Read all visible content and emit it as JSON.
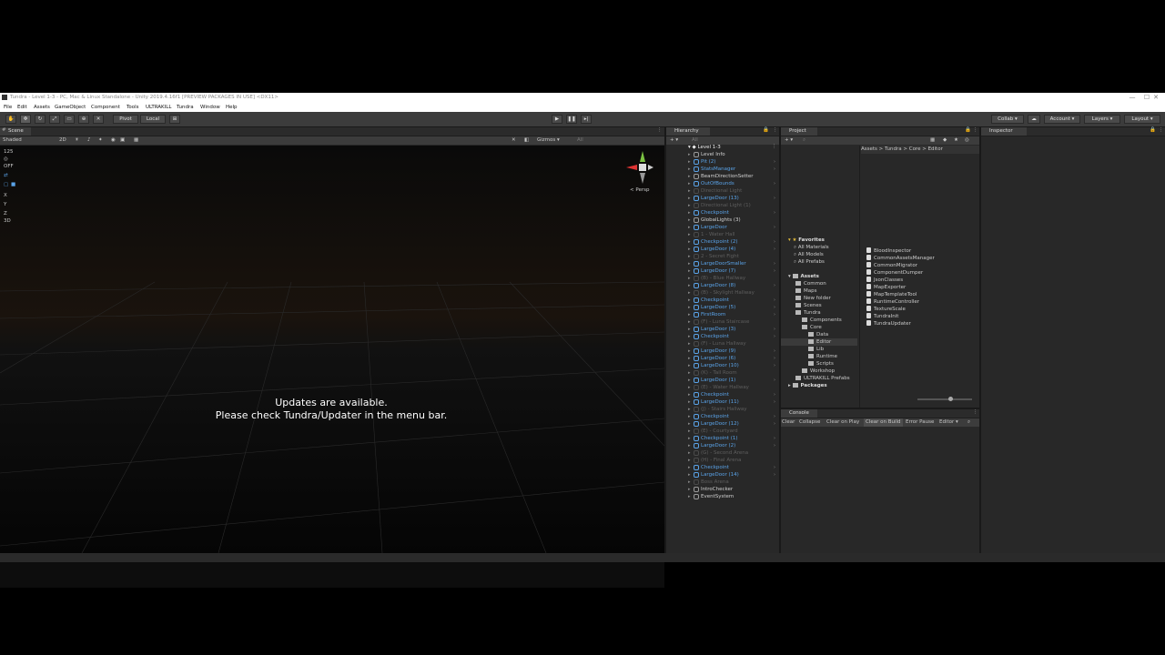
{
  "window": {
    "title": "Tundra - Level 1-3 - PC, Mac & Linux Standalone - Unity 2019.4.16f1 [PREVIEW PACKAGES IN USE] <DX11>",
    "min": "—",
    "max": "☐",
    "close": "✕"
  },
  "menu": [
    "File",
    "Edit",
    "Assets",
    "GameObject",
    "Component",
    "Tools",
    "ULTRAKILL",
    "Tundra",
    "Window",
    "Help"
  ],
  "toolbar": {
    "pivot": "Pivot",
    "local": "Local",
    "collab": "Collab ▾",
    "account": "Account ▾",
    "layers": "Layers ▾",
    "layout": "Layout ▾"
  },
  "scene": {
    "tab": "Scene",
    "shading": "Shaded",
    "mode2d": "2D",
    "gizmos": "Gizmos ▾",
    "search": "All",
    "persp": "< Persp",
    "side": [
      "125",
      "◎",
      "OFF",
      "⇄",
      "▢",
      "■",
      "X",
      "Y",
      "Z",
      "3D"
    ],
    "message_line1": "Updates are available.",
    "message_line2": "Please check Tundra/Updater in the menu bar."
  },
  "hierarchy": {
    "tab": "Hierarchy",
    "search": "All",
    "scene": "Level 1-3",
    "items": [
      {
        "label": "Level Info",
        "color": "#d0d0d0",
        "icon": "#9a9a9a",
        "arrow": false
      },
      {
        "label": "Pit (2)",
        "color": "#5aa3e8",
        "icon": "#5aa3e8",
        "arrow": true
      },
      {
        "label": "StatsManager",
        "color": "#5aa3e8",
        "icon": "#5aa3e8",
        "arrow": true
      },
      {
        "label": "BeamDirectionSetter",
        "color": "#d0d0d0",
        "icon": "#9a9a9a",
        "arrow": false
      },
      {
        "label": "OutOfBounds",
        "color": "#5aa3e8",
        "icon": "#5aa3e8",
        "arrow": true
      },
      {
        "label": "Directional Light",
        "color": "#5e5e5e",
        "icon": "#4a4a4a",
        "arrow": false
      },
      {
        "label": "LargeDoor (13)",
        "color": "#5aa3e8",
        "icon": "#5aa3e8",
        "arrow": true
      },
      {
        "label": "Directional Light (1)",
        "color": "#5e5e5e",
        "icon": "#4a4a4a",
        "arrow": false
      },
      {
        "label": "Checkpoint",
        "color": "#5aa3e8",
        "icon": "#5aa3e8",
        "arrow": true
      },
      {
        "label": "GlobalLights (3)",
        "color": "#d0d0d0",
        "icon": "#9a9a9a",
        "arrow": false
      },
      {
        "label": "LargeDoor",
        "color": "#5aa3e8",
        "icon": "#5aa3e8",
        "arrow": true
      },
      {
        "label": "1 - Water Hall",
        "color": "#5e5e5e",
        "icon": "#4a4a4a",
        "arrow": false
      },
      {
        "label": "Checkpoint (2)",
        "color": "#5aa3e8",
        "icon": "#5aa3e8",
        "arrow": true
      },
      {
        "label": "LargeDoor (4)",
        "color": "#5aa3e8",
        "icon": "#5aa3e8",
        "arrow": true
      },
      {
        "label": "2 - Secret Fight",
        "color": "#5e5e5e",
        "icon": "#4a4a4a",
        "arrow": false
      },
      {
        "label": "LargeDoorSmaller",
        "color": "#5aa3e8",
        "icon": "#5aa3e8",
        "arrow": true
      },
      {
        "label": "LargeDoor (7)",
        "color": "#5aa3e8",
        "icon": "#5aa3e8",
        "arrow": true
      },
      {
        "label": "(B) - Blue Hallway",
        "color": "#5e5e5e",
        "icon": "#4a4a4a",
        "arrow": false
      },
      {
        "label": "LargeDoor (8)",
        "color": "#5aa3e8",
        "icon": "#5aa3e8",
        "arrow": true
      },
      {
        "label": "(B) - Skylight Hallway",
        "color": "#5e5e5e",
        "icon": "#4a4a4a",
        "arrow": false
      },
      {
        "label": "Checkpoint",
        "color": "#5aa3e8",
        "icon": "#5aa3e8",
        "arrow": true
      },
      {
        "label": "LargeDoor (5)",
        "color": "#5aa3e8",
        "icon": "#5aa3e8",
        "arrow": true
      },
      {
        "label": "FirstRoom",
        "color": "#5aa3e8",
        "icon": "#5aa3e8",
        "arrow": true
      },
      {
        "label": "(F) - Luna Staircase",
        "color": "#5e5e5e",
        "icon": "#4a4a4a",
        "arrow": false
      },
      {
        "label": "LargeDoor (3)",
        "color": "#5aa3e8",
        "icon": "#5aa3e8",
        "arrow": true
      },
      {
        "label": "Checkpoint",
        "color": "#5aa3e8",
        "icon": "#5aa3e8",
        "arrow": true
      },
      {
        "label": "(F) - Luna Hallway",
        "color": "#5e5e5e",
        "icon": "#4a4a4a",
        "arrow": false
      },
      {
        "label": "LargeDoor (9)",
        "color": "#5aa3e8",
        "icon": "#5aa3e8",
        "arrow": true
      },
      {
        "label": "LargeDoor (6)",
        "color": "#5aa3e8",
        "icon": "#5aa3e8",
        "arrow": true
      },
      {
        "label": "LargeDoor (10)",
        "color": "#5aa3e8",
        "icon": "#5aa3e8",
        "arrow": true
      },
      {
        "label": "(K) - Tall Room",
        "color": "#5e5e5e",
        "icon": "#4a4a4a",
        "arrow": false
      },
      {
        "label": "LargeDoor (1)",
        "color": "#5aa3e8",
        "icon": "#5aa3e8",
        "arrow": true
      },
      {
        "label": "(E) - Water Hallway",
        "color": "#5e5e5e",
        "icon": "#4a4a4a",
        "arrow": false
      },
      {
        "label": "Checkpoint",
        "color": "#5aa3e8",
        "icon": "#5aa3e8",
        "arrow": true
      },
      {
        "label": "LargeDoor (11)",
        "color": "#5aa3e8",
        "icon": "#5aa3e8",
        "arrow": true
      },
      {
        "label": "(J) - Stairs Hallway",
        "color": "#5e5e5e",
        "icon": "#4a4a4a",
        "arrow": false
      },
      {
        "label": "Checkpoint",
        "color": "#5aa3e8",
        "icon": "#5aa3e8",
        "arrow": true
      },
      {
        "label": "LargeDoor (12)",
        "color": "#5aa3e8",
        "icon": "#5aa3e8",
        "arrow": true
      },
      {
        "label": "(E) - Courtyard",
        "color": "#5e5e5e",
        "icon": "#4a4a4a",
        "arrow": false
      },
      {
        "label": "Checkpoint (1)",
        "color": "#5aa3e8",
        "icon": "#5aa3e8",
        "arrow": true
      },
      {
        "label": "LargeDoor (2)",
        "color": "#5aa3e8",
        "icon": "#5aa3e8",
        "arrow": true
      },
      {
        "label": "(G) - Second Arena",
        "color": "#5e5e5e",
        "icon": "#4a4a4a",
        "arrow": false
      },
      {
        "label": "(H) - Final Arena",
        "color": "#5e5e5e",
        "icon": "#4a4a4a",
        "arrow": false
      },
      {
        "label": "Checkpoint",
        "color": "#5aa3e8",
        "icon": "#5aa3e8",
        "arrow": true
      },
      {
        "label": "LargeDoor (14)",
        "color": "#5aa3e8",
        "icon": "#5aa3e8",
        "arrow": true
      },
      {
        "label": "Boss Arena",
        "color": "#5e5e5e",
        "icon": "#4a4a4a",
        "arrow": false
      },
      {
        "label": "IntroChecker",
        "color": "#d0d0d0",
        "icon": "#9a9a9a",
        "arrow": false
      },
      {
        "label": "EventSystem",
        "color": "#d0d0d0",
        "icon": "#9a9a9a",
        "arrow": false
      }
    ]
  },
  "project": {
    "tab": "Project",
    "favorites": "Favorites",
    "fav_items": [
      "All Materials",
      "All Models",
      "All Prefabs"
    ],
    "assets": "Assets",
    "tree": [
      {
        "label": "Common",
        "indent": 0
      },
      {
        "label": "Maps",
        "indent": 0
      },
      {
        "label": "New folder",
        "indent": 0
      },
      {
        "label": "Scenes",
        "indent": 0
      },
      {
        "label": "Tundra",
        "indent": 0
      },
      {
        "label": "Components",
        "indent": 1
      },
      {
        "label": "Core",
        "indent": 1
      },
      {
        "label": "Data",
        "indent": 2
      },
      {
        "label": "Editor",
        "indent": 2
      },
      {
        "label": "Lib",
        "indent": 2
      },
      {
        "label": "Runtime",
        "indent": 2
      },
      {
        "label": "Scripts",
        "indent": 2
      },
      {
        "label": "Workshop",
        "indent": 1
      },
      {
        "label": "ULTRAKILL Prefabs",
        "indent": 0
      }
    ],
    "packages": "Packages",
    "breadcrumb": "Assets > Tundra > Core > Editor",
    "files": [
      "BloodInspector",
      "CommonAssetsManager",
      "CommonMigrator",
      "ComponentDumper",
      "JsonClasses",
      "MapExporter",
      "MapTemplateTool",
      "RuntimeController",
      "TextureScale",
      "TundraInit",
      "TundraUpdater"
    ]
  },
  "console": {
    "tab": "Console",
    "buttons": [
      "Clear",
      "Collapse",
      "Clear on Play",
      "Clear on Build",
      "Error Pause",
      "Editor ▾"
    ]
  },
  "inspector": {
    "tab": "Inspector"
  }
}
